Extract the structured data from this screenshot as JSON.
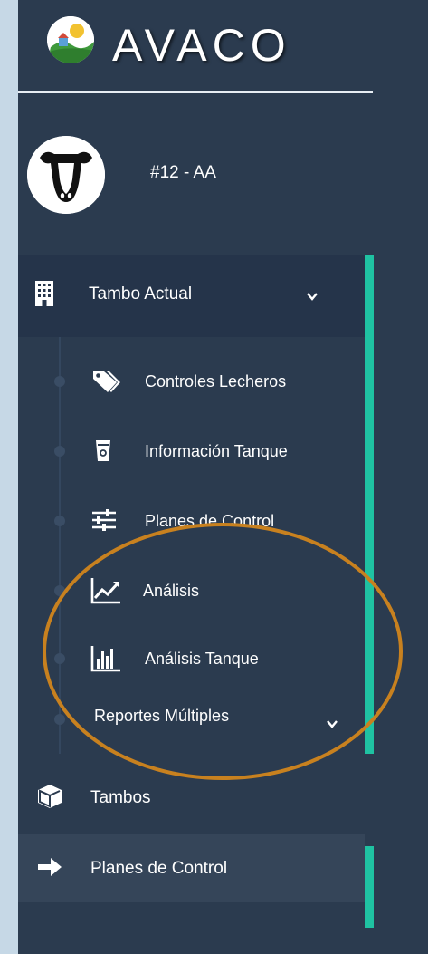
{
  "brand": {
    "name": "AVACO",
    "logo_icon": "farm-logo-icon"
  },
  "user": {
    "name": "#12 - AA",
    "avatar_icon": "cow-head-icon"
  },
  "menu": {
    "section": {
      "label": "Tambo Actual",
      "icon": "building-icon",
      "expanded": true
    },
    "sub_items": [
      {
        "label": "Controles Lecheros",
        "icon": "tags-icon"
      },
      {
        "label": "Información Tanque",
        "icon": "tank-icon"
      },
      {
        "label": "Planes de Control",
        "icon": "sliders-icon"
      },
      {
        "label": "Análisis",
        "icon": "line-chart-icon"
      },
      {
        "label": "Análisis Tanque",
        "icon": "bar-chart-icon"
      },
      {
        "label": "Reportes Múltiples",
        "icon": "chevron-down-icon"
      }
    ],
    "tambos": {
      "label": "Tambos",
      "icon": "cube-icon"
    },
    "planes": {
      "label": "Planes de Control",
      "icon": "arrow-right-icon",
      "active": true
    }
  },
  "colors": {
    "sidebar_bg": "#2b3b4f",
    "accent": "#1fc2a2",
    "annotation": "#c8811f",
    "page_bg": "#c6d8e6"
  }
}
